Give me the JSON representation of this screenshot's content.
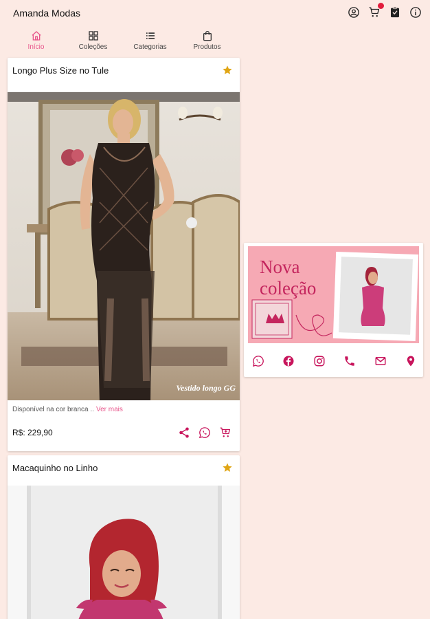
{
  "app": {
    "title": "Amanda Modas"
  },
  "top_icons": [
    "account-circle-icon",
    "cart-icon",
    "clipboard-icon",
    "info-icon"
  ],
  "tabs": [
    {
      "label": "Início",
      "icon": "home-icon",
      "active": true
    },
    {
      "label": "Coleções",
      "icon": "grid-icon",
      "active": false
    },
    {
      "label": "Categorias",
      "icon": "list-icon",
      "active": false
    },
    {
      "label": "Produtos",
      "icon": "shopping-bag-icon",
      "active": false
    }
  ],
  "products": [
    {
      "title": "Longo Plus Size no Tule",
      "image_caption": "Vestido longo GG",
      "description": "Disponível na cor branca ..",
      "more_link": "Ver mais",
      "price": "R$: 229,90",
      "favorite": true,
      "actions": [
        "share-icon",
        "whatsapp-icon",
        "cart-icon"
      ]
    },
    {
      "title": "Macaquinho no Linho",
      "favorite": true
    }
  ],
  "banner": {
    "line1": "Nova",
    "line2": "coleção",
    "social": [
      "whatsapp-icon",
      "facebook-icon",
      "instagram-icon",
      "phone-icon",
      "email-icon",
      "location-icon"
    ]
  },
  "colors": {
    "background": "#fceae4",
    "accent": "#e8558b",
    "social": "#c8155c",
    "star": "#e0a514",
    "banner_bg": "#f6a9b4",
    "banner_text": "#c4265e"
  }
}
